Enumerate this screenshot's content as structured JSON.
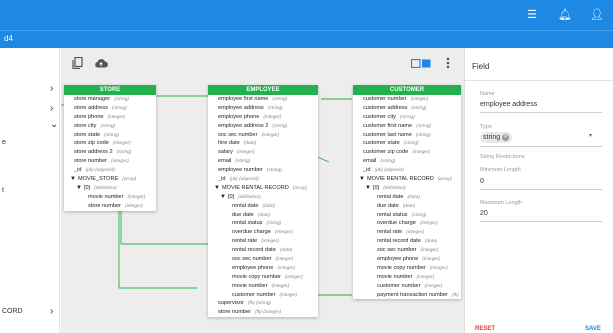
{
  "header": {
    "breadcrumb": "d4"
  },
  "nav": {
    "items": [
      {
        "label": "",
        "chevron": "›"
      },
      {
        "label": "",
        "chevron": "›"
      },
      {
        "label": "",
        "chevron": "⌄"
      },
      {
        "label": "e",
        "chevron": ""
      },
      {
        "label": "t",
        "chevron": ""
      },
      {
        "label": "CORD",
        "chevron": "›"
      }
    ]
  },
  "toolbar": {
    "copy_icon": "copy-icon",
    "cloud_icon": "cloud-upload-icon",
    "view_icon": "view-toggle-icon",
    "more_icon": "more-vert-icon"
  },
  "tables": {
    "store": {
      "title": "STORE",
      "rows": [
        {
          "name": "store manager",
          "type": "(string)"
        },
        {
          "name": "store address",
          "type": "(string)"
        },
        {
          "name": "store phone",
          "type": "(integer)"
        },
        {
          "name": "store city",
          "type": "(string)"
        },
        {
          "name": "store state",
          "type": "(string)"
        },
        {
          "name": "store zip code",
          "type": "(integer)"
        },
        {
          "name": "store address 2",
          "type": "(string)"
        },
        {
          "name": "store number",
          "type": "(integer)"
        },
        {
          "name": "_id",
          "type": "(pk) (objectid)"
        },
        {
          "name": "MOVIE_STORE",
          "type": "(array)",
          "toggle": "▼"
        },
        {
          "name": "[0]",
          "type": "(definition)",
          "toggle": "▼"
        },
        {
          "name": "movie number",
          "type": "(integer)"
        },
        {
          "name": "store number",
          "type": "(integer)"
        }
      ]
    },
    "employee": {
      "title": "EMPLOYEE",
      "rows": [
        {
          "name": "employee first name",
          "type": "(string)"
        },
        {
          "name": "employee address",
          "type": "(string)"
        },
        {
          "name": "employee phone",
          "type": "(integer)"
        },
        {
          "name": "employee address 2",
          "type": "(string)"
        },
        {
          "name": "soc sec number",
          "type": "(integer)"
        },
        {
          "name": "hire date",
          "type": "(date)"
        },
        {
          "name": "salary",
          "type": "(integer)"
        },
        {
          "name": "email",
          "type": "(string)"
        },
        {
          "name": "employee number",
          "type": "(string)"
        },
        {
          "name": "_id",
          "type": "(pk) (objectid)"
        },
        {
          "name": "MOVIE RENTAL RECORD",
          "type": "(array)",
          "toggle": "▼"
        },
        {
          "name": "[0]",
          "type": "(definition)",
          "toggle": "▼"
        },
        {
          "name": "rental date",
          "type": "(date)"
        },
        {
          "name": "due date",
          "type": "(date)"
        },
        {
          "name": "rental status",
          "type": "(string)"
        },
        {
          "name": "overdue charge",
          "type": "(integer)"
        },
        {
          "name": "rental rate",
          "type": "(integer)"
        },
        {
          "name": "rental record date",
          "type": "(date)"
        },
        {
          "name": "soc sec number",
          "type": "(integer)"
        },
        {
          "name": "employee phone",
          "type": "(integer)"
        },
        {
          "name": "movie copy number",
          "type": "(integer)"
        },
        {
          "name": "movie number",
          "type": "(integer)"
        },
        {
          "name": "customer number",
          "type": "(integer)"
        },
        {
          "name": "supervisor",
          "type": "(fk) (string)"
        },
        {
          "name": "store number",
          "type": "(fk) (integer)"
        }
      ]
    },
    "customer": {
      "title": "CUSTOMER",
      "rows": [
        {
          "name": "customer number",
          "type": "(integer)"
        },
        {
          "name": "customer address",
          "type": "(string)"
        },
        {
          "name": "customer city",
          "type": "(string)"
        },
        {
          "name": "customer first name",
          "type": "(string)"
        },
        {
          "name": "customer last name",
          "type": "(string)"
        },
        {
          "name": "customer state",
          "type": "(string)"
        },
        {
          "name": "customer zip code",
          "type": "(integer)"
        },
        {
          "name": "email",
          "type": "(string)"
        },
        {
          "name": "_id",
          "type": "(pk) (objectid)"
        },
        {
          "name": "MOVIE RENTAL RECORD",
          "type": "(array)",
          "toggle": "▼"
        },
        {
          "name": "[0]",
          "type": "(definition)",
          "toggle": "▼"
        },
        {
          "name": "rental date",
          "type": "(date)"
        },
        {
          "name": "due date",
          "type": "(date)"
        },
        {
          "name": "rental status",
          "type": "(string)"
        },
        {
          "name": "overdue charge",
          "type": "(integer)"
        },
        {
          "name": "rental rate",
          "type": "(integer)"
        },
        {
          "name": "rental record date",
          "type": "(date)"
        },
        {
          "name": "soc sec number",
          "type": "(integer)"
        },
        {
          "name": "employee phone",
          "type": "(integer)"
        },
        {
          "name": "movie copy number",
          "type": "(integer)"
        },
        {
          "name": "movie number",
          "type": "(integer)"
        },
        {
          "name": "customer number",
          "type": "(integer)"
        },
        {
          "name": "payment transaction number",
          "type": "(fk)"
        }
      ]
    }
  },
  "panel": {
    "title": "Field",
    "name_label": "Name",
    "name_value": "employee address",
    "type_label": "Type",
    "type_value": "string",
    "restrictions_label": "String Restrictions",
    "min_label": "Minimum Length",
    "min_value": "0",
    "max_label": "Maximum Length",
    "max_value": "20",
    "reset_label": "RESET",
    "save_label": "SAVE"
  },
  "colors": {
    "primary": "#1e88e5",
    "table_header": "#22b14c",
    "reset": "#e53935"
  }
}
